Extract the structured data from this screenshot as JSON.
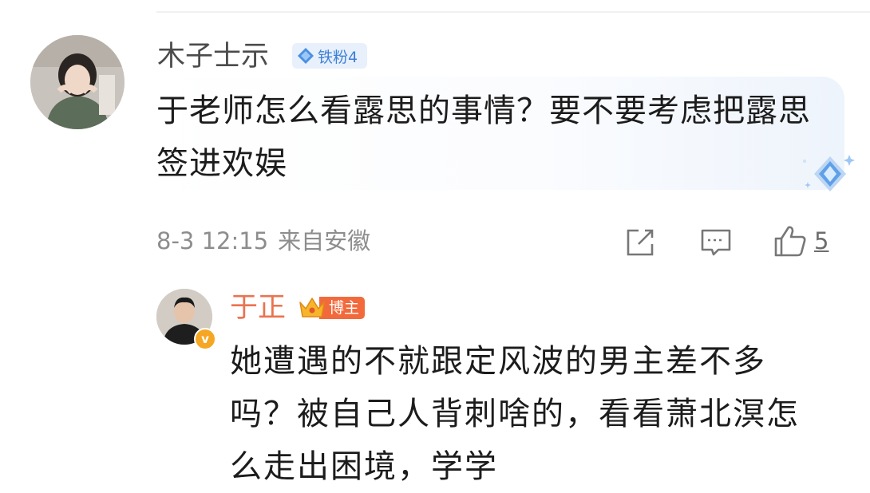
{
  "comment": {
    "username": "木子士示",
    "fan_badge": "铁粉4",
    "text": "于老师怎么看露思的事情？要不要考虑把露思签进欢娱",
    "date": "8-3 12:15",
    "location": "来自安徽",
    "like_count": "5"
  },
  "reply": {
    "username": "于正",
    "badge": "博主",
    "verified_mark": "v",
    "text": "她遭遇的不就跟定风波的男主差不多吗？被自己人背刺啥的，看看萧北溟怎么走出困境，学学"
  },
  "colors": {
    "reply_name": "#eb7350",
    "badge_blue": "#3f7fd6",
    "blogger_badge": "#f26a3c",
    "meta_gray": "#8d8d8d"
  },
  "icons": [
    "diamond-icon",
    "edit-icon",
    "comment-icon",
    "like-icon",
    "crown-icon",
    "verified-icon"
  ]
}
